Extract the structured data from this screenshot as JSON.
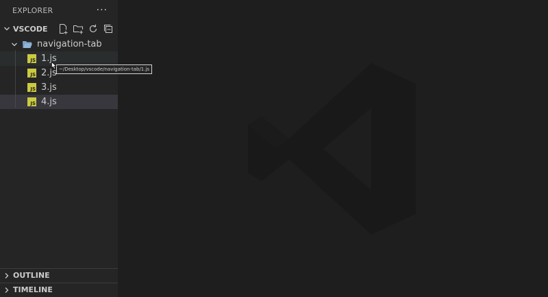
{
  "explorer": {
    "title": "EXPLORER",
    "more_label": "···"
  },
  "workspace": {
    "name": "VSCODE",
    "actions": [
      "new-file-icon",
      "new-folder-icon",
      "refresh-icon",
      "collapse-all-icon"
    ]
  },
  "tree": {
    "folder": "navigation-tab",
    "files": [
      {
        "name": "1.js",
        "state": "hover"
      },
      {
        "name": "2.js",
        "state": "normal"
      },
      {
        "name": "3.js",
        "state": "normal"
      },
      {
        "name": "4.js",
        "state": "selected"
      }
    ],
    "tooltip": "~/Desktop/vscode/navigation-tab/1.js"
  },
  "sections": {
    "outline": "OUTLINE",
    "timeline": "TIMELINE"
  },
  "colors": {
    "sidebar_bg": "#252526",
    "editor_bg": "#1e1e1e",
    "js_icon": "#cbcb41",
    "selected_row": "#37373d"
  }
}
